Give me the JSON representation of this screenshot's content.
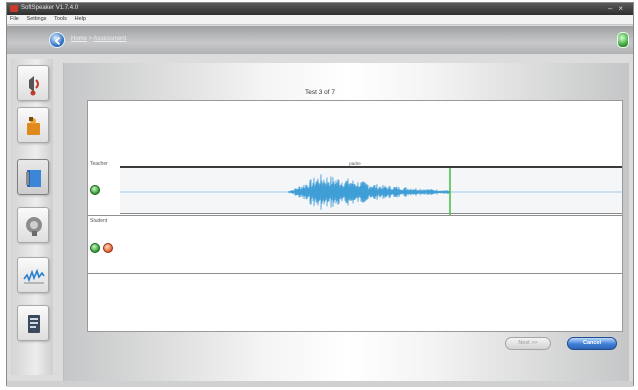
{
  "window": {
    "title": "SoftSpeaker  V1.7.4.0"
  },
  "menu": [
    "File",
    "Settings",
    "Tools",
    "Help"
  ],
  "nav": {
    "breadcrumb_home": "Home",
    "breadcrumb_sep": " > ",
    "breadcrumb_current": "Assessment"
  },
  "sidebar": {
    "items": [
      {
        "name": "sidebar-item-lesson",
        "icon": "speaker-icon"
      },
      {
        "name": "sidebar-item-practice",
        "icon": "puzzle-icon"
      },
      {
        "name": "sidebar-item-record",
        "icon": "book-icon"
      },
      {
        "name": "sidebar-item-listen",
        "icon": "head-icon"
      },
      {
        "name": "sidebar-item-analysis",
        "icon": "waveform-icon"
      },
      {
        "name": "sidebar-item-report",
        "icon": "report-icon"
      }
    ]
  },
  "main": {
    "test_label": "Test 3 of 7",
    "teacher_label": "Teacher",
    "student_label": "Student",
    "track_name": "padre"
  },
  "buttons": {
    "next": "Next >>",
    "cancel": "Cancel"
  },
  "colors": {
    "accent": "#3f7fd6",
    "wave": "#3f9ed6",
    "marker": "#4cc24c",
    "play": "#2f9f2f",
    "record": "#e0612a"
  }
}
